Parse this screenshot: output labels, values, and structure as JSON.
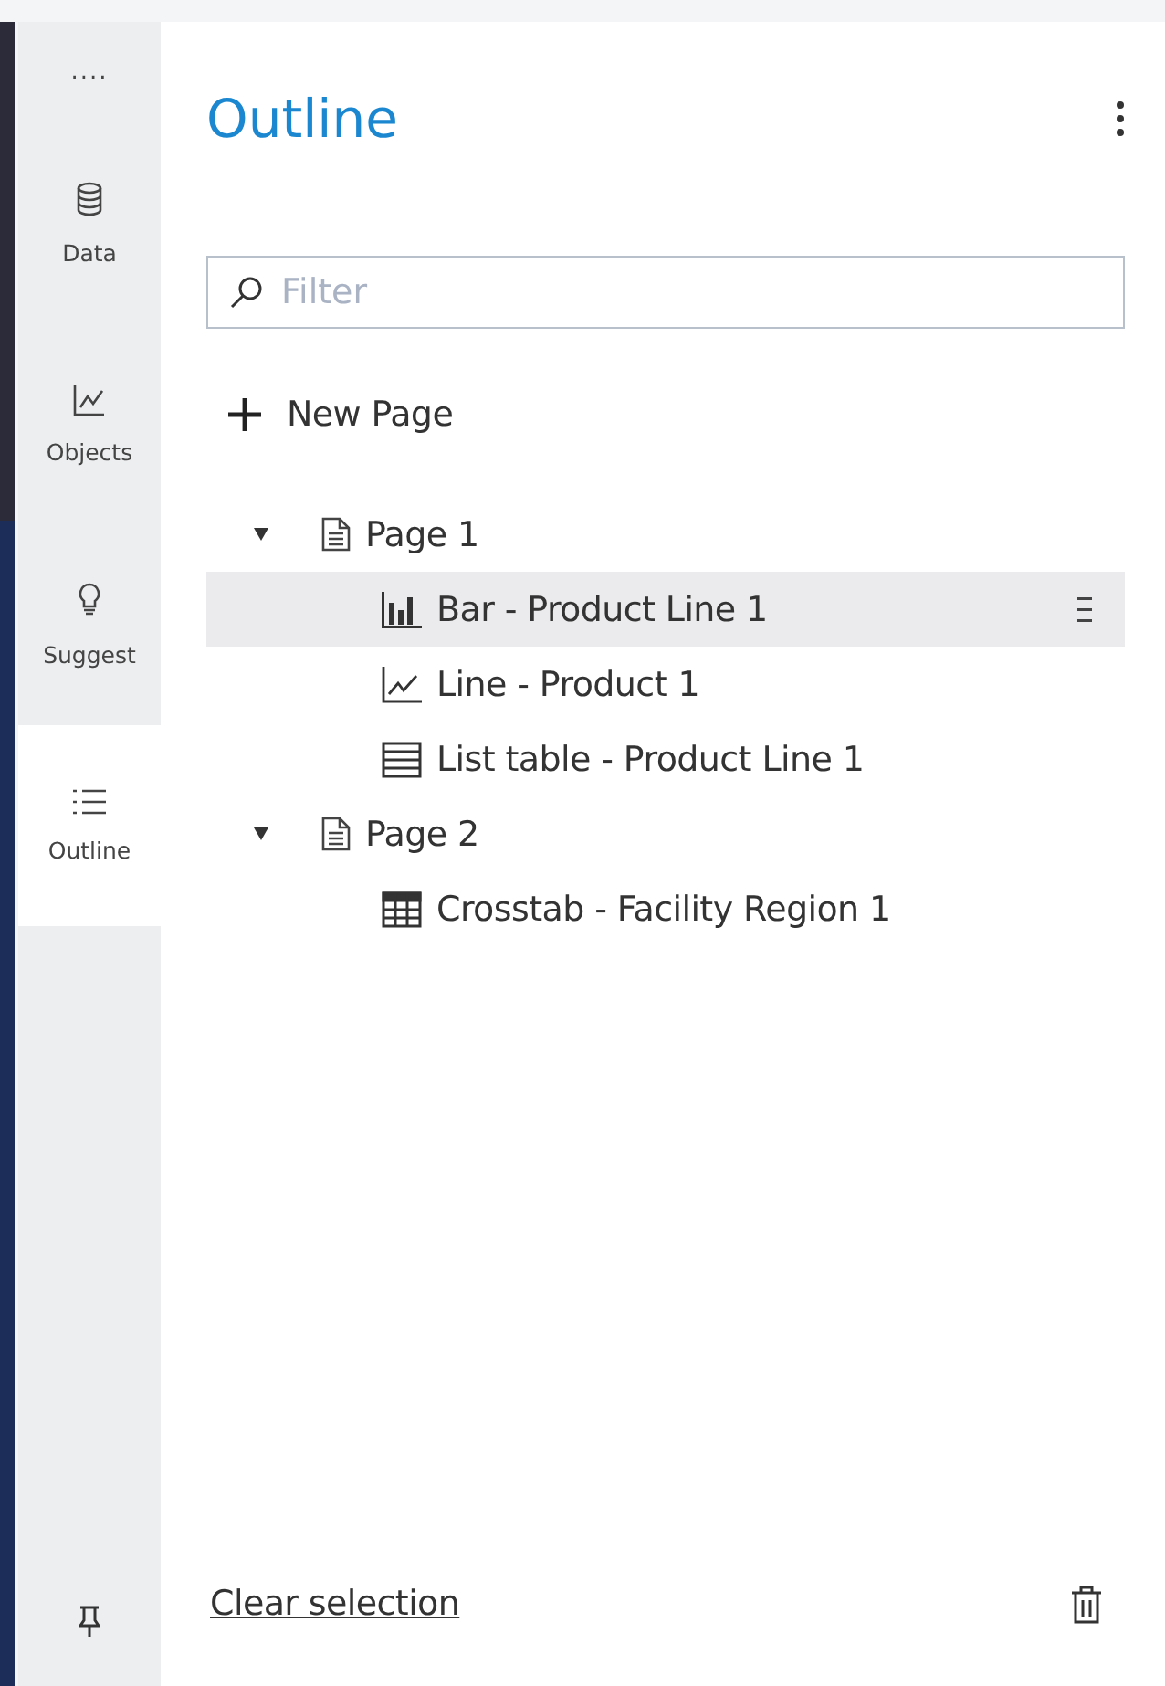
{
  "sidebar": {
    "more": "....",
    "items": [
      {
        "label": "Data",
        "kind": "data",
        "selected": false
      },
      {
        "label": "Objects",
        "kind": "objects",
        "selected": false
      },
      {
        "label": "Suggest",
        "kind": "suggest",
        "selected": false
      },
      {
        "label": "Outline",
        "kind": "outline",
        "selected": true
      }
    ]
  },
  "panel": {
    "title": "Outline",
    "filter": {
      "placeholder": "Filter"
    },
    "new_page": "New Page",
    "tree": [
      {
        "label": "Page 1",
        "expanded": true,
        "selected": false,
        "children": [
          {
            "label": "Bar - Product Line 1",
            "kind": "bar",
            "selected": true
          },
          {
            "label": "Line - Product 1",
            "kind": "line",
            "selected": false
          },
          {
            "label": "List table - Product Line 1",
            "kind": "table",
            "selected": false
          }
        ]
      },
      {
        "label": "Page 2",
        "expanded": true,
        "selected": false,
        "children": [
          {
            "label": "Crosstab - Facility Region 1",
            "kind": "crosstab",
            "selected": false
          }
        ]
      }
    ],
    "clear_selection": "Clear selection"
  }
}
